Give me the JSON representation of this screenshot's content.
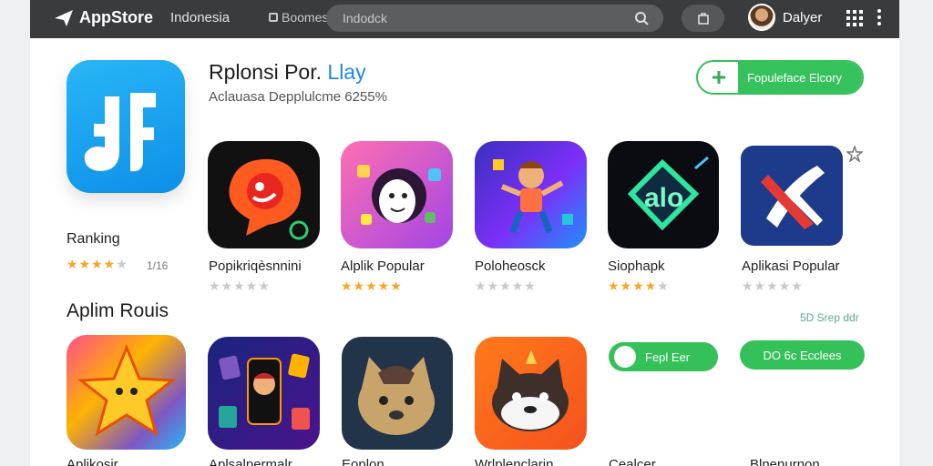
{
  "topbar": {
    "brand": "AppStore",
    "region": "Indonesia",
    "category_tab": "Boomes",
    "search_placeholder": "Indodck",
    "user_name": "Dalyer"
  },
  "hero": {
    "title_prefix": "Rplonsi Por. ",
    "title_accent": "Llay",
    "subtitle": "Aclauasa Depplulcme 6255%",
    "install_label": "Fopuleface Elcory",
    "ranking_label": "Ranking",
    "rating": 4,
    "rating_count": "1/16",
    "accent_color": "#34c15a"
  },
  "top_apps": [
    {
      "name": "Popikriqèsnnini",
      "rating": 0
    },
    {
      "name": "Alplik Popular",
      "rating": 5
    },
    {
      "name": "Poloheosck",
      "rating": 0
    },
    {
      "name": "Siophapk",
      "rating": 4
    },
    {
      "name": "Aplikasi Popular",
      "rating": 0
    }
  ],
  "section": {
    "title": "Aplim Rouis",
    "see_more": "5D Srep ddr"
  },
  "second_row": {
    "pill_one": "Fepl Eer",
    "pill_two": "DO 6c Ecclees",
    "partial_names": [
      "Aplikosir",
      "Aplsalpermalr",
      "Eoplon",
      "Wrlplenclarin",
      "Cealcer",
      "Blnenurnon"
    ]
  }
}
